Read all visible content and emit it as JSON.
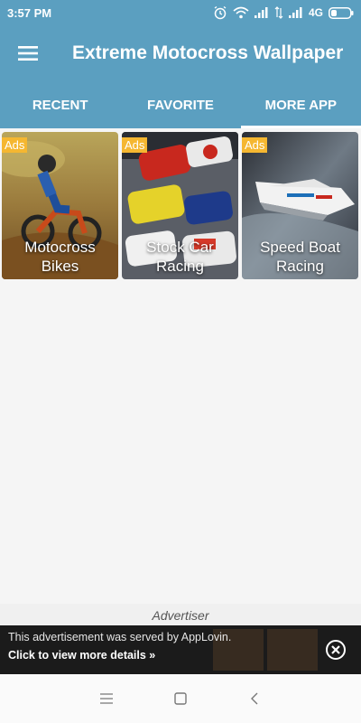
{
  "status_bar": {
    "time": "3:57 PM",
    "network": "4G"
  },
  "app_bar": {
    "title": "Extreme Motocross Wallpaper"
  },
  "tabs": [
    {
      "label": "RECENT",
      "active": false
    },
    {
      "label": "FAVORITE",
      "active": false
    },
    {
      "label": "MORE APP",
      "active": true
    }
  ],
  "apps": [
    {
      "badge": "Ads",
      "label": "Motocross Bikes"
    },
    {
      "badge": "Ads",
      "label": "Stock Car Racing"
    },
    {
      "badge": "Ads",
      "label": "Speed Boat Racing"
    }
  ],
  "ad": {
    "advertiser_label": "Advertiser",
    "served_text": "This advertisement was served by AppLovin.",
    "cta_text": "Click to view more details »"
  },
  "colors": {
    "primary": "#5b9fc0",
    "ads_badge": "#f5b731"
  },
  "icons": [
    "menu-icon",
    "alarm-icon",
    "wifi-icon",
    "signal-icon",
    "battery-icon",
    "close-icon",
    "nav-menu-icon",
    "nav-home-icon",
    "nav-back-icon"
  ]
}
